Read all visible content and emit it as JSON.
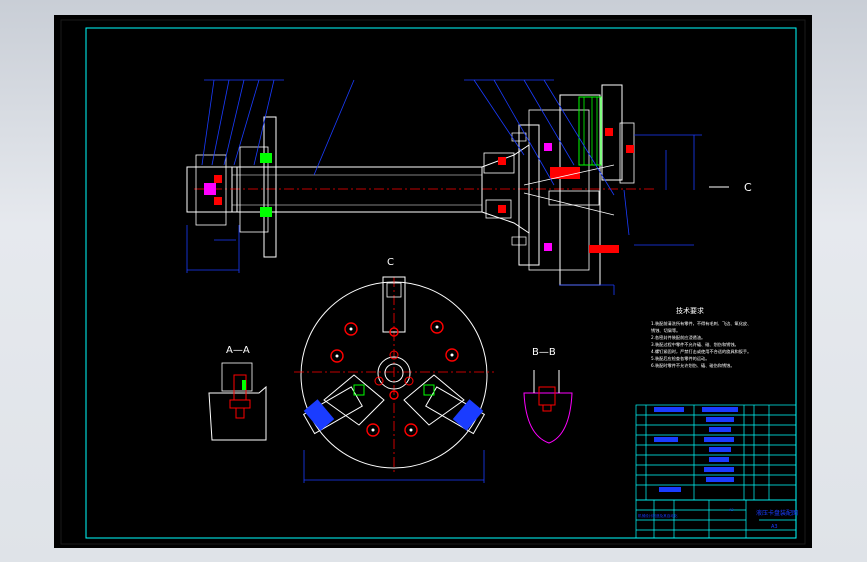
{
  "colors": {
    "background": "#000000",
    "frame": "#00ffff",
    "drawing": "#ffffff",
    "accent": "#ff0000",
    "dimension": "#1a3cff",
    "part": "#ff00ff",
    "highlight": "#00ff00",
    "viewport": "#d4d8de"
  },
  "drawing": {
    "main_view_label": "C",
    "top_view_label": "C",
    "section_a_label": "A—A",
    "section_b_label": "B—B",
    "notes_title": "技术要求",
    "notes": [
      "1.装配前清洗所有零件，不得有毛刺、飞边、氧化皮、",
      "锈蚀、切屑等。",
      "2.各密封件装配前应浸透油。",
      "3.装配过程中零件不允许磕、碰、划伤和锈蚀。",
      "4.螺钉紧固时，严禁打击或使用不合适的旋具和扳手。",
      "5.装配后应检查各零件的运动。",
      "6.装配时零件不允许划伤、磕、碰伤和锈蚀。"
    ],
    "scale": "A3",
    "title_block": {
      "name": "液压卡盘装配图",
      "sheet": "A3",
      "school": "机械设计制造及其自动化"
    }
  }
}
